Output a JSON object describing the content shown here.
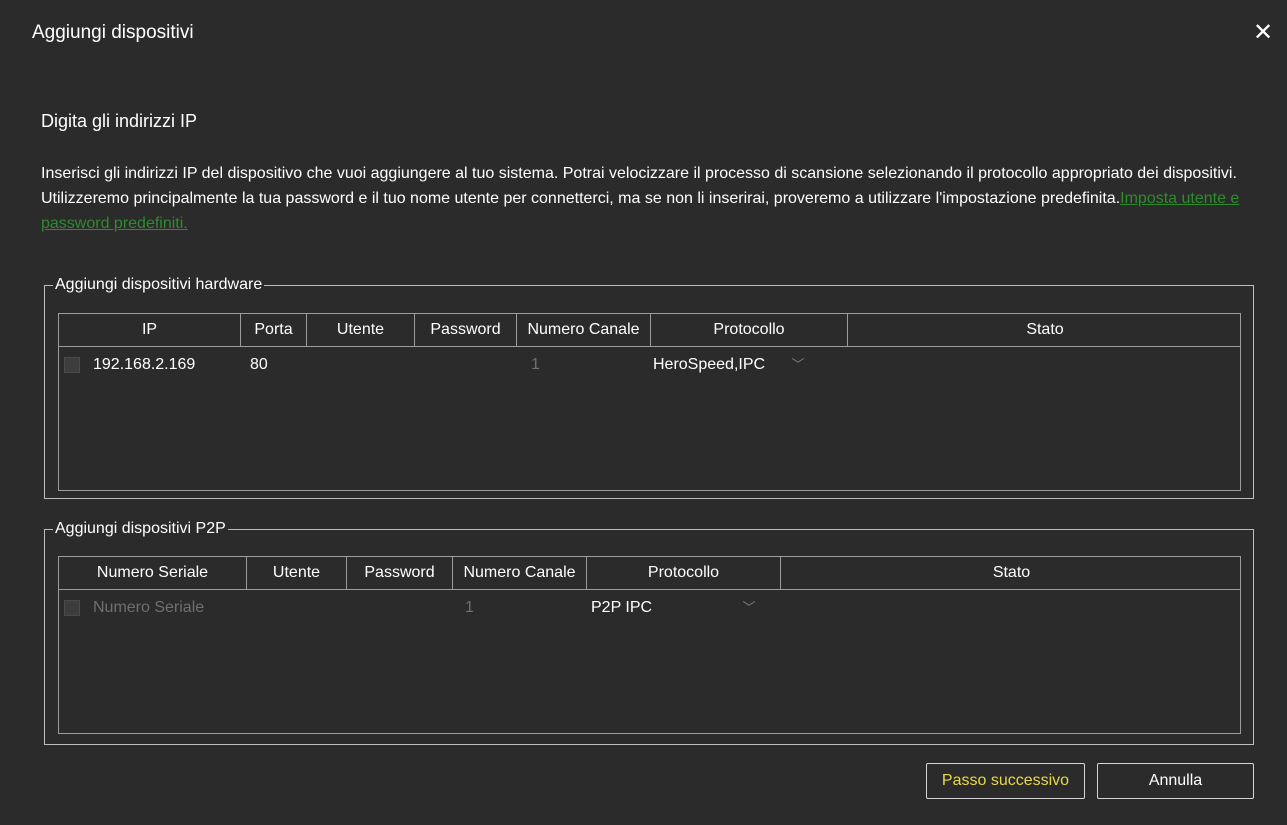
{
  "dialog": {
    "title": "Aggiungi dispositivi",
    "close_icon": "close-icon"
  },
  "intro": {
    "heading": "Digita gli indirizzi IP",
    "text": "Inserisci gli indirizzi IP del dispositivo che vuoi aggiungere al tuo sistema. Potrai velocizzare il processo di scansione selezionando il protocollo appropriato dei dispositivi. Utilizzeremo principalmente la tua password e il tuo nome utente per connetterci, ma se non li inserirai, proveremo a utilizzare l'impostazione predefinita.",
    "link": "Imposta utente e password predefiniti."
  },
  "hardware": {
    "legend": "Aggiungi dispositivi hardware",
    "columns": [
      "IP",
      "Porta",
      "Utente",
      "Password",
      "Numero Canale",
      "Protocollo",
      "Stato"
    ],
    "row": {
      "ip": "192.168.2.169",
      "porta": "80",
      "utente": "",
      "password": "",
      "canale": "1",
      "protocollo": "HeroSpeed,IPC",
      "stato": ""
    }
  },
  "p2p": {
    "legend": "Aggiungi dispositivi P2P",
    "columns": [
      "Numero Seriale",
      "Utente",
      "Password",
      "Numero Canale",
      "Protocollo",
      "Stato"
    ],
    "row": {
      "seriale_placeholder": "Numero Seriale",
      "utente": "",
      "password": "",
      "canale": "1",
      "protocollo": "P2P IPC",
      "stato": ""
    }
  },
  "buttons": {
    "next": "Passo successivo",
    "cancel": "Annulla"
  },
  "colors": {
    "background": "#2b2b2b",
    "link": "#2e8b2e",
    "next_text": "#e8d84a"
  }
}
